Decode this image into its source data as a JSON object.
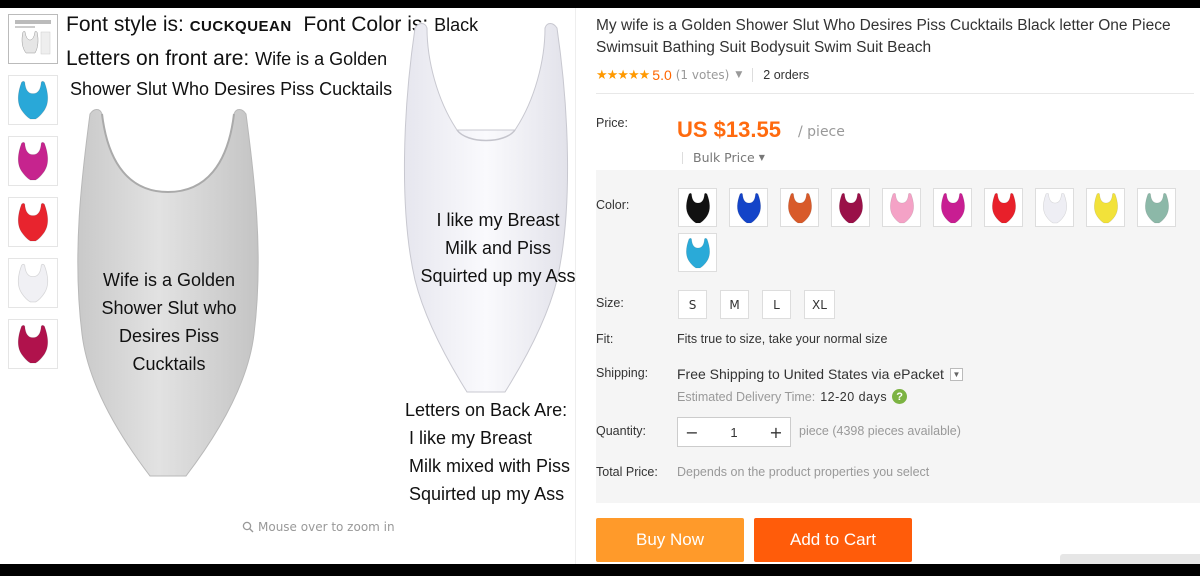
{
  "gallery": {
    "thumbnails": [
      {
        "name": "thumb-size-chart",
        "color": "#dddddd"
      },
      {
        "name": "thumb-blue",
        "color": "#29a8d8"
      },
      {
        "name": "thumb-magenta",
        "color": "#c6248e"
      },
      {
        "name": "thumb-red",
        "color": "#e8242e"
      },
      {
        "name": "thumb-white",
        "color": "#f0f0f4"
      },
      {
        "name": "thumb-burgundy",
        "color": "#b0124c"
      }
    ],
    "main_image": {
      "line1_prefix": "Font style is: ",
      "line1_font": "CUCKQUEAN",
      "line1_color_label": "Font Color is: ",
      "line1_color": "Black",
      "line2_prefix": "Letters on front are: ",
      "line2_text": "Wife is a Golden",
      "line3_text": "Shower Slut Who Desires Piss Cucktails",
      "front_print": [
        "Wife is a Golden",
        "Shower Slut who",
        "Desires Piss",
        "Cucktails"
      ],
      "back_print": [
        "I like my Breast",
        "Milk and Piss",
        "Squirted up my Ass"
      ],
      "back_caption": [
        "Letters on Back Are:",
        "I like my Breast",
        "Milk mixed with Piss",
        "Squirted up my Ass"
      ]
    },
    "zoom_hint": "Mouse over to zoom in"
  },
  "product": {
    "title": "My wife is a Golden Shower Slut Who Desires Piss Cucktails Black letter One Piece Swimsuit Bathing Suit Bodysuit Swim Suit Beach",
    "rating": "5.0",
    "stars": "★★★★★",
    "votes": "(1 votes)",
    "orders": "2 orders"
  },
  "price": {
    "label": "Price:",
    "amount": "US $13.55",
    "unit": "/ piece",
    "bulk_label": "Bulk Price"
  },
  "options": {
    "color_label": "Color:",
    "colors": [
      {
        "name": "swatch-black",
        "color": "#111111"
      },
      {
        "name": "swatch-royal-blue",
        "color": "#1444c8"
      },
      {
        "name": "swatch-orange",
        "color": "#d85a2a"
      },
      {
        "name": "swatch-wine",
        "color": "#9a1048"
      },
      {
        "name": "swatch-pink",
        "color": "#f4a2c6"
      },
      {
        "name": "swatch-magenta",
        "color": "#c81e92"
      },
      {
        "name": "swatch-red",
        "color": "#e8202a"
      },
      {
        "name": "swatch-white",
        "color": "#eeeef4"
      },
      {
        "name": "swatch-yellow",
        "color": "#f2e23a"
      },
      {
        "name": "swatch-sage",
        "color": "#8cb8a8"
      },
      {
        "name": "swatch-sky-blue",
        "color": "#2aaad8"
      }
    ],
    "size_label": "Size:",
    "sizes": [
      "S",
      "M",
      "L",
      "XL"
    ],
    "fit_label": "Fit:",
    "fit_text": "Fits true to size, take your normal size",
    "shipping_label": "Shipping:",
    "shipping_text": "Free Shipping to United States via ePacket",
    "eta_label": "Estimated Delivery Time:",
    "eta_days": "12-20 days",
    "quantity_label": "Quantity:",
    "quantity_value": "1",
    "quantity_minus": "−",
    "quantity_plus": "+",
    "quantity_available": "piece (4398 pieces available)",
    "total_label": "Total Price:",
    "total_text": "Depends on the product properties you select"
  },
  "actions": {
    "buy_now": "Buy Now",
    "add_to_cart": "Add to Cart"
  },
  "colors": {
    "price_orange": "#ff6a0e",
    "buy_now": "#ff9a2a",
    "add_to_cart": "#ff5c0a",
    "star": "#ff9900"
  }
}
